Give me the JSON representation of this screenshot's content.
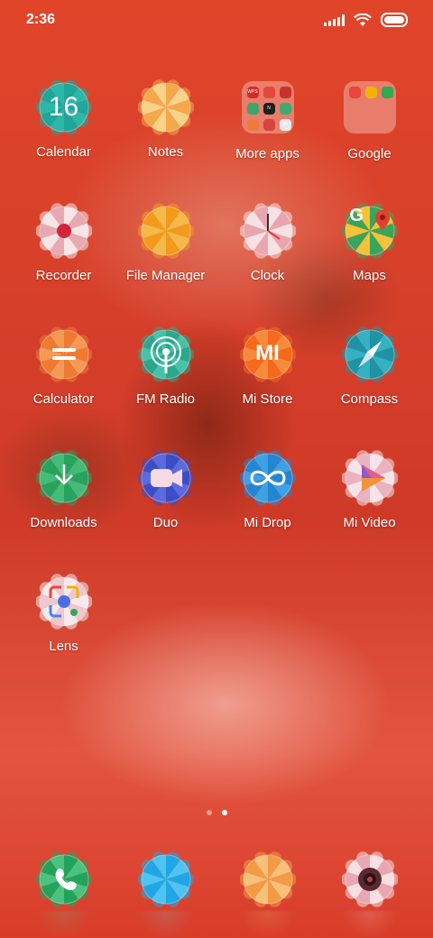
{
  "status_bar": {
    "time": "2:36"
  },
  "apps": [
    {
      "id": "calendar",
      "label": "Calendar",
      "date": "16",
      "colors": [
        "#1fa59a",
        "#2bb8a8"
      ]
    },
    {
      "id": "notes",
      "label": "Notes",
      "colors": [
        "#f5a84a",
        "#fbd28a"
      ]
    },
    {
      "id": "more-apps",
      "label": "More apps"
    },
    {
      "id": "google",
      "label": "Google"
    },
    {
      "id": "recorder",
      "label": "Recorder",
      "colors": [
        "#f7e5e7",
        "#e8a9b2"
      ]
    },
    {
      "id": "file-manager",
      "label": "File Manager",
      "colors": [
        "#f29a1b",
        "#f5b84a"
      ]
    },
    {
      "id": "clock",
      "label": "Clock",
      "colors": [
        "#f8e1e4",
        "#e9a6b0"
      ]
    },
    {
      "id": "maps",
      "label": "Maps",
      "colors": [
        "#3aa55a",
        "#f2c23a"
      ]
    },
    {
      "id": "calculator",
      "label": "Calculator",
      "colors": [
        "#f07a32",
        "#f59a55"
      ]
    },
    {
      "id": "fm-radio",
      "label": "FM Radio",
      "colors": [
        "#2aa88d",
        "#46c2a6"
      ]
    },
    {
      "id": "mi-store",
      "label": "Mi Store",
      "logo": "mi",
      "colors": [
        "#f5691a",
        "#f88a3c"
      ]
    },
    {
      "id": "compass",
      "label": "Compass",
      "colors": [
        "#1e93a6",
        "#35b1c4"
      ]
    },
    {
      "id": "downloads",
      "label": "Downloads",
      "colors": [
        "#27a35e",
        "#45bb79"
      ]
    },
    {
      "id": "duo",
      "label": "Duo",
      "colors": [
        "#3b4ec7",
        "#5a6be0"
      ]
    },
    {
      "id": "mi-drop",
      "label": "Mi Drop",
      "colors": [
        "#2485d0",
        "#3ea1e6"
      ]
    },
    {
      "id": "mi-video",
      "label": "Mi Video",
      "colors": [
        "#f7e4e8",
        "#eab3bf"
      ]
    },
    {
      "id": "lens",
      "label": "Lens",
      "colors": [
        "#f7e9ec",
        "#efc7cf"
      ]
    }
  ],
  "folder_more_apps": {
    "mini_colors": [
      "#d62b2b",
      "#e4473b",
      "#c7322a",
      "#3fa56a",
      "#1f1f1f",
      "#3eaa73",
      "#ef7a3a",
      "#d7443a",
      "#e9e9e9"
    ],
    "mini_labels": [
      "WPS",
      "",
      "",
      "",
      "N",
      "",
      "",
      "",
      "Mi Pay"
    ]
  },
  "folder_google": {
    "mini_colors": [
      "#e9473b",
      "#f2b400",
      "#34a853"
    ]
  },
  "dock": [
    {
      "id": "phone",
      "colors": [
        "#22a35b",
        "#4cc27f"
      ]
    },
    {
      "id": "browser",
      "colors": [
        "#1fa6e6",
        "#4ec4f3"
      ]
    },
    {
      "id": "gallery",
      "colors": [
        "#f39a45",
        "#f8c07a"
      ]
    },
    {
      "id": "camera",
      "colors": [
        "#f7dfe4",
        "#e7a8b3"
      ]
    }
  ],
  "page_indicator": {
    "pages": 2,
    "current": 2
  }
}
